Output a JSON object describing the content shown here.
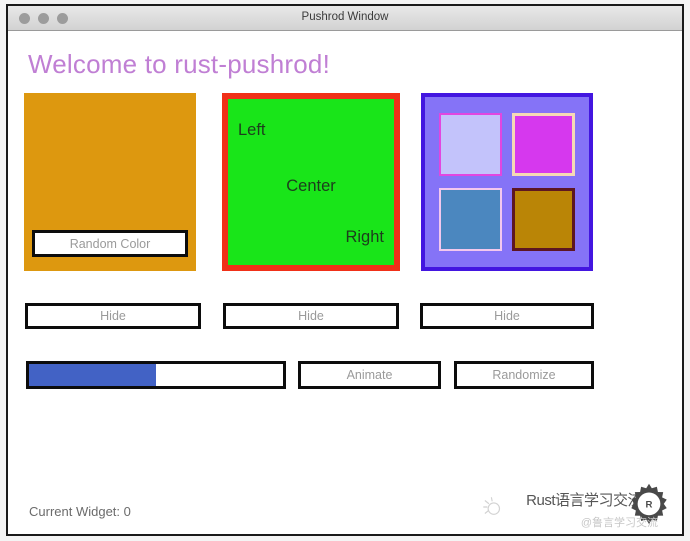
{
  "window": {
    "title": "Pushrod Window",
    "traffic_lights": [
      {
        "name": "close",
        "color": "#9c9c9c"
      },
      {
        "name": "minimize",
        "color": "#9c9c9c"
      },
      {
        "name": "zoom",
        "color": "#9c9c9c"
      }
    ]
  },
  "heading": {
    "text": "Welcome to rust-pushrod!",
    "color": "#c07fd4"
  },
  "widgets": {
    "orange_box": {
      "fill_color": "#dd980f",
      "button_label": "Random Color"
    },
    "green_box": {
      "fill_color": "#19e519",
      "border_color": "#f03018",
      "label_left": "Left",
      "label_center": "Center",
      "label_right": "Right"
    },
    "purple_box": {
      "fill_color": "#8573f7",
      "border_color": "#4316e0",
      "sub_boxes": [
        {
          "name": "lavender-box",
          "fill": "#c3c3fb",
          "border": "#e246e0"
        },
        {
          "name": "magenta-box",
          "fill": "#d638ee",
          "border": "#f6d9b5"
        },
        {
          "name": "steel-blue-box",
          "fill": "#4b87bf",
          "border": "#f3c8ee"
        },
        {
          "name": "goldenrod-box",
          "fill": "#ba8506",
          "border": "#5d1622"
        }
      ]
    }
  },
  "hide_buttons": [
    {
      "label": "Hide"
    },
    {
      "label": "Hide"
    },
    {
      "label": "Hide"
    }
  ],
  "controls": {
    "progress": {
      "value": 50,
      "max": 100,
      "fill_color": "#4262c5"
    },
    "animate_label": "Animate",
    "randomize_label": "Randomize"
  },
  "status": {
    "text": "Current Widget: 0"
  },
  "watermark": {
    "text": "Rust语言学习交流",
    "subtext": "@鲁言学习交流",
    "gear_icon": "rust-gear-icon",
    "spark_icon": "sparkle-icon"
  }
}
